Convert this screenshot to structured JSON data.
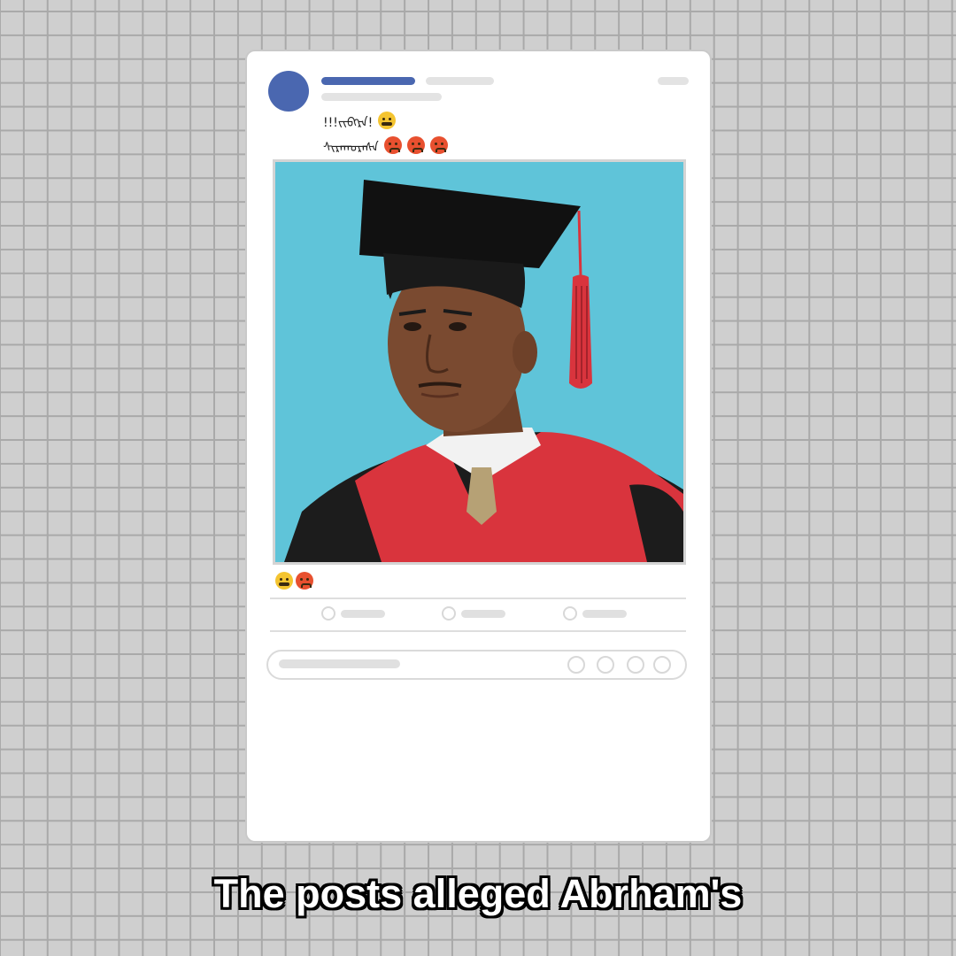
{
  "post": {
    "caption_line1": "!!!ᠵᠢᠪᠭᠷᠠ!",
    "caption_line2": "ᠰᠢᠷᠠᠬᠤᠷᠠᠰᠠ",
    "caption_line1_emojis": [
      "grimacing-emoji"
    ],
    "caption_line2_emojis": [
      "angry-emoji",
      "angry-emoji",
      "angry-emoji"
    ],
    "photo_subject": "graduation-portrait",
    "reaction_emojis": [
      "grimacing-emoji",
      "angry-emoji"
    ]
  },
  "subtitle": "The posts alleged Abrham's",
  "colors": {
    "brand_blue": "#4a67b0",
    "photo_background": "#5fc4d9",
    "gown_red": "#d9343d"
  }
}
